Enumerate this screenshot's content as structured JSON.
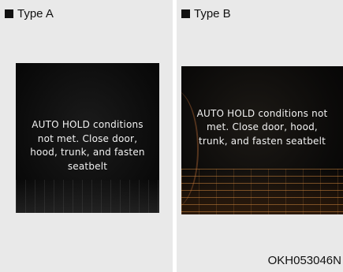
{
  "type_a": {
    "label": "Type A",
    "message": "AUTO HOLD conditions not met. Close door, hood, trunk, and fasten seatbelt"
  },
  "type_b": {
    "label": "Type B",
    "message": "AUTO HOLD conditions not met. Close door, hood, trunk, and fasten seatbelt"
  },
  "figure_code": "OKH053046N",
  "colors": {
    "background": "#e9e9e9",
    "screen": "#0b0b0b",
    "text": "#f2f2f2",
    "type_b_accent": "#c8823c"
  }
}
